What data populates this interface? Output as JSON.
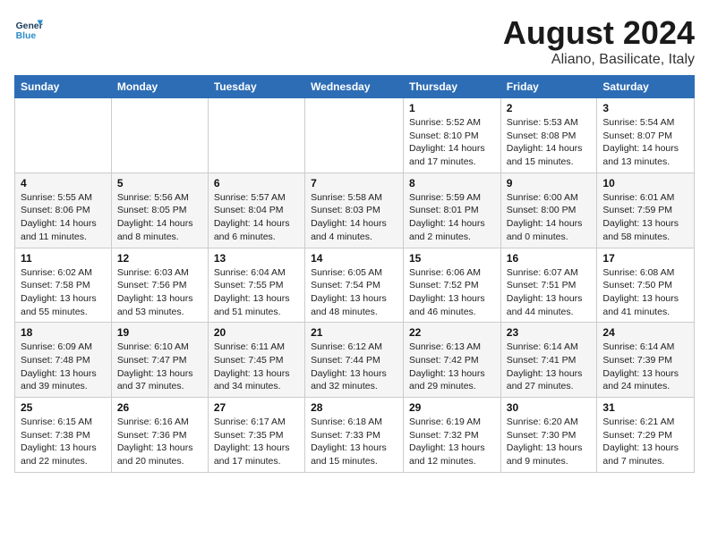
{
  "header": {
    "logo_line1": "General",
    "logo_line2": "Blue",
    "main_title": "August 2024",
    "subtitle": "Aliano, Basilicate, Italy"
  },
  "weekdays": [
    "Sunday",
    "Monday",
    "Tuesday",
    "Wednesday",
    "Thursday",
    "Friday",
    "Saturday"
  ],
  "weeks": [
    [
      {
        "day": "",
        "info": ""
      },
      {
        "day": "",
        "info": ""
      },
      {
        "day": "",
        "info": ""
      },
      {
        "day": "",
        "info": ""
      },
      {
        "day": "1",
        "info": "Sunrise: 5:52 AM\nSunset: 8:10 PM\nDaylight: 14 hours\nand 17 minutes."
      },
      {
        "day": "2",
        "info": "Sunrise: 5:53 AM\nSunset: 8:08 PM\nDaylight: 14 hours\nand 15 minutes."
      },
      {
        "day": "3",
        "info": "Sunrise: 5:54 AM\nSunset: 8:07 PM\nDaylight: 14 hours\nand 13 minutes."
      }
    ],
    [
      {
        "day": "4",
        "info": "Sunrise: 5:55 AM\nSunset: 8:06 PM\nDaylight: 14 hours\nand 11 minutes."
      },
      {
        "day": "5",
        "info": "Sunrise: 5:56 AM\nSunset: 8:05 PM\nDaylight: 14 hours\nand 8 minutes."
      },
      {
        "day": "6",
        "info": "Sunrise: 5:57 AM\nSunset: 8:04 PM\nDaylight: 14 hours\nand 6 minutes."
      },
      {
        "day": "7",
        "info": "Sunrise: 5:58 AM\nSunset: 8:03 PM\nDaylight: 14 hours\nand 4 minutes."
      },
      {
        "day": "8",
        "info": "Sunrise: 5:59 AM\nSunset: 8:01 PM\nDaylight: 14 hours\nand 2 minutes."
      },
      {
        "day": "9",
        "info": "Sunrise: 6:00 AM\nSunset: 8:00 PM\nDaylight: 14 hours\nand 0 minutes."
      },
      {
        "day": "10",
        "info": "Sunrise: 6:01 AM\nSunset: 7:59 PM\nDaylight: 13 hours\nand 58 minutes."
      }
    ],
    [
      {
        "day": "11",
        "info": "Sunrise: 6:02 AM\nSunset: 7:58 PM\nDaylight: 13 hours\nand 55 minutes."
      },
      {
        "day": "12",
        "info": "Sunrise: 6:03 AM\nSunset: 7:56 PM\nDaylight: 13 hours\nand 53 minutes."
      },
      {
        "day": "13",
        "info": "Sunrise: 6:04 AM\nSunset: 7:55 PM\nDaylight: 13 hours\nand 51 minutes."
      },
      {
        "day": "14",
        "info": "Sunrise: 6:05 AM\nSunset: 7:54 PM\nDaylight: 13 hours\nand 48 minutes."
      },
      {
        "day": "15",
        "info": "Sunrise: 6:06 AM\nSunset: 7:52 PM\nDaylight: 13 hours\nand 46 minutes."
      },
      {
        "day": "16",
        "info": "Sunrise: 6:07 AM\nSunset: 7:51 PM\nDaylight: 13 hours\nand 44 minutes."
      },
      {
        "day": "17",
        "info": "Sunrise: 6:08 AM\nSunset: 7:50 PM\nDaylight: 13 hours\nand 41 minutes."
      }
    ],
    [
      {
        "day": "18",
        "info": "Sunrise: 6:09 AM\nSunset: 7:48 PM\nDaylight: 13 hours\nand 39 minutes."
      },
      {
        "day": "19",
        "info": "Sunrise: 6:10 AM\nSunset: 7:47 PM\nDaylight: 13 hours\nand 37 minutes."
      },
      {
        "day": "20",
        "info": "Sunrise: 6:11 AM\nSunset: 7:45 PM\nDaylight: 13 hours\nand 34 minutes."
      },
      {
        "day": "21",
        "info": "Sunrise: 6:12 AM\nSunset: 7:44 PM\nDaylight: 13 hours\nand 32 minutes."
      },
      {
        "day": "22",
        "info": "Sunrise: 6:13 AM\nSunset: 7:42 PM\nDaylight: 13 hours\nand 29 minutes."
      },
      {
        "day": "23",
        "info": "Sunrise: 6:14 AM\nSunset: 7:41 PM\nDaylight: 13 hours\nand 27 minutes."
      },
      {
        "day": "24",
        "info": "Sunrise: 6:14 AM\nSunset: 7:39 PM\nDaylight: 13 hours\nand 24 minutes."
      }
    ],
    [
      {
        "day": "25",
        "info": "Sunrise: 6:15 AM\nSunset: 7:38 PM\nDaylight: 13 hours\nand 22 minutes."
      },
      {
        "day": "26",
        "info": "Sunrise: 6:16 AM\nSunset: 7:36 PM\nDaylight: 13 hours\nand 20 minutes."
      },
      {
        "day": "27",
        "info": "Sunrise: 6:17 AM\nSunset: 7:35 PM\nDaylight: 13 hours\nand 17 minutes."
      },
      {
        "day": "28",
        "info": "Sunrise: 6:18 AM\nSunset: 7:33 PM\nDaylight: 13 hours\nand 15 minutes."
      },
      {
        "day": "29",
        "info": "Sunrise: 6:19 AM\nSunset: 7:32 PM\nDaylight: 13 hours\nand 12 minutes."
      },
      {
        "day": "30",
        "info": "Sunrise: 6:20 AM\nSunset: 7:30 PM\nDaylight: 13 hours\nand 9 minutes."
      },
      {
        "day": "31",
        "info": "Sunrise: 6:21 AM\nSunset: 7:29 PM\nDaylight: 13 hours\nand 7 minutes."
      }
    ]
  ]
}
